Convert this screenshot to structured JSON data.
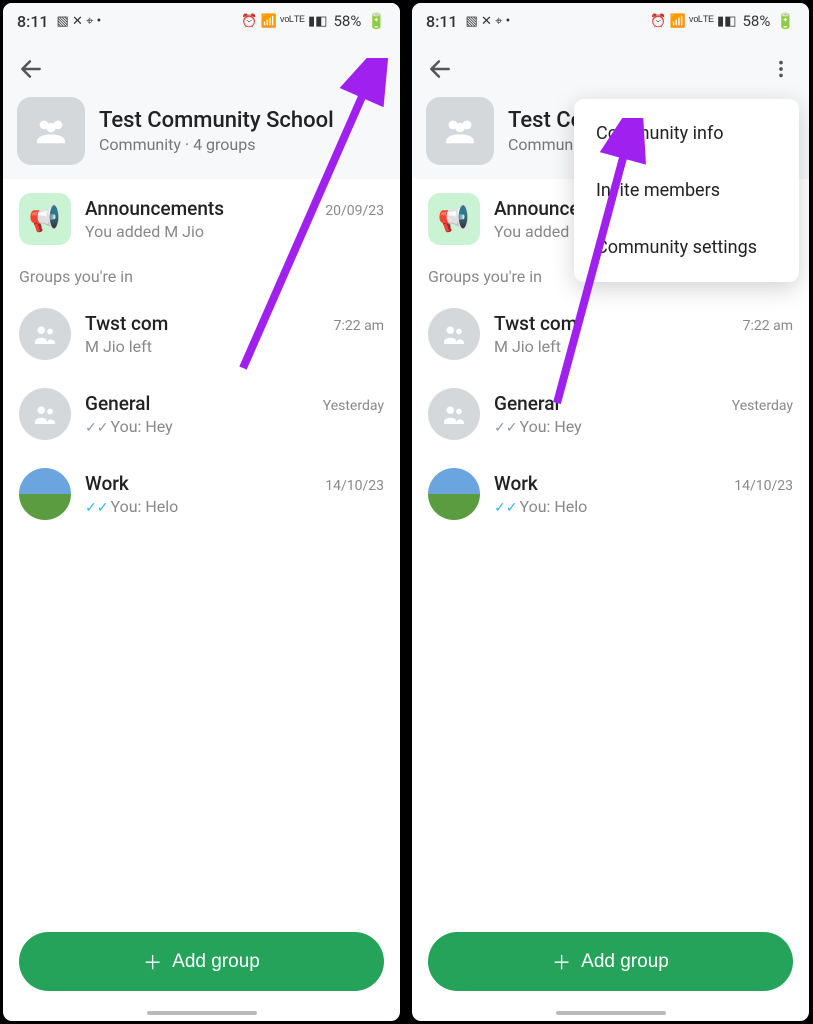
{
  "status": {
    "time": "8:11",
    "battery": "58%"
  },
  "header": {
    "title": "Test Community School",
    "subtitle": "Community · 4 groups"
  },
  "announcements": {
    "title": "Announcements",
    "subtitle": "You added M Jio",
    "date": "20/09/23"
  },
  "groups_label": "Groups you're in",
  "groups": [
    {
      "name": "Twst com",
      "subtitle": "M Jio left",
      "time": "7:22 am",
      "ticks": ""
    },
    {
      "name": "General",
      "subtitle": "You: Hey",
      "time": "Yesterday",
      "ticks": "gray"
    },
    {
      "name": "Work",
      "subtitle": "You: Helo",
      "time": "14/10/23",
      "ticks": "blue"
    }
  ],
  "add_group": "Add group",
  "popup": {
    "item1": "Community info",
    "item2": "Invite members",
    "item3": "Community settings"
  }
}
